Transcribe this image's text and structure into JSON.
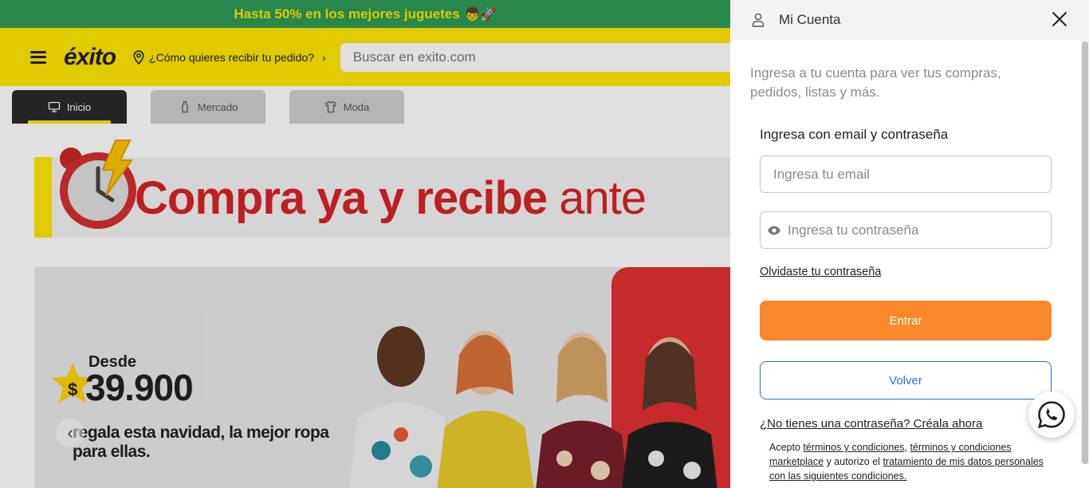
{
  "promo": {
    "text": "Hasta 50% en los mejores juguetes",
    "emoji": "👦🚀"
  },
  "header": {
    "logo": "éxito",
    "location_prompt": "¿Cómo quieres recibir tu pedido?",
    "search_placeholder": "Buscar en exito.com"
  },
  "tabs": [
    {
      "label": "Inicio",
      "icon": "monitor-icon",
      "active": true
    },
    {
      "label": "Mercado",
      "icon": "bottle-icon",
      "active": false
    },
    {
      "label": "Moda",
      "icon": "shirt-icon",
      "active": false
    }
  ],
  "banner_top": {
    "text_bold": "Compra ya y recibe",
    "text_thin": "ante"
  },
  "banner_main": {
    "from_label": "Desde",
    "currency": "$",
    "price": "39.900",
    "tagline": "regala esta navidad, la mejor ropa para ellas."
  },
  "panel": {
    "title": "Mi Cuenta",
    "intro": "Ingresa a tu cuenta para ver tus compras, pedidos, listas y más.",
    "login_label": "Ingresa con email y contraseña",
    "email_placeholder": "Ingresa tu email",
    "password_placeholder": "Ingresa tu contraseña",
    "forgot_label": "Olvidaste tu contraseña",
    "enter_label": "Entrar",
    "back_label": "Volver",
    "signup_label": "¿No tienes una contraseña? Créala ahora",
    "legal": {
      "prefix": "Acepto ",
      "terms": "términos y condiciones",
      "sep1": ", ",
      "terms_marketplace": "términos y condiciones marketplace",
      "middle": " y autorizo el ",
      "data_treatment": "tratamiento de mis datos personales con las siguientes condiciones."
    }
  },
  "colors": {
    "promo_bg": "#2e9b57",
    "promo_text": "#ffe600",
    "header_bg": "#ffe600",
    "accent_orange": "#f7882b",
    "link_blue": "#2b72c8",
    "banner_red": "#d8232a"
  }
}
